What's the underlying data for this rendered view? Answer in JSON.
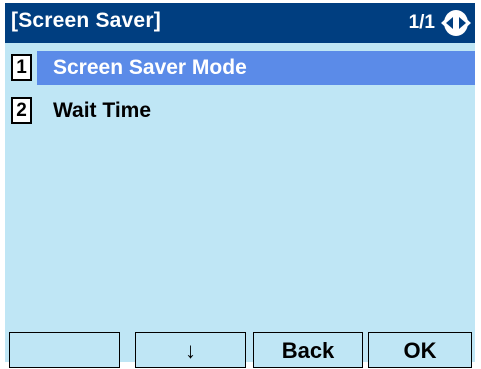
{
  "header": {
    "title": "[Screen Saver]",
    "page_indicator": "1/1",
    "nav_icon": "left-right-nav-icon"
  },
  "menu": {
    "items": [
      {
        "number": "1",
        "label": "Screen Saver Mode",
        "selected": true
      },
      {
        "number": "2",
        "label": "Wait Time",
        "selected": false
      }
    ]
  },
  "softkeys": {
    "key1": "",
    "key2": "↓",
    "key3": "Back",
    "key4": "OK"
  },
  "colors": {
    "title_bar": "#003e80",
    "background": "#bfe6f5",
    "selection": "#5b8be8"
  }
}
